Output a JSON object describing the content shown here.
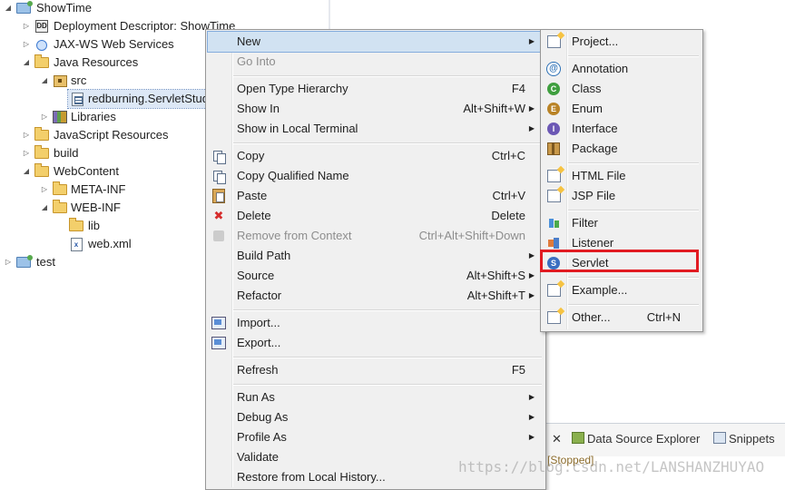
{
  "explorer": {
    "items": [
      {
        "label": "ShowTime",
        "icon": "web-project-icon",
        "expanded": true
      },
      {
        "label": "Deployment Descriptor: ShowTime",
        "icon": "deployment-descriptor-icon",
        "expanded": false
      },
      {
        "label": "JAX-WS Web Services",
        "icon": "jaxws-icon",
        "expanded": false
      },
      {
        "label": "Java Resources",
        "icon": "java-resources-icon",
        "expanded": true
      },
      {
        "label": "src",
        "icon": "source-folder-icon",
        "expanded": true
      },
      {
        "label": "redburning.ServletStud",
        "icon": "package-icon",
        "selected": true
      },
      {
        "label": "Libraries",
        "icon": "libraries-icon",
        "expanded": false
      },
      {
        "label": "JavaScript Resources",
        "icon": "javascript-resources-icon",
        "expanded": false
      },
      {
        "label": "build",
        "icon": "folder-icon",
        "expanded": false
      },
      {
        "label": "WebContent",
        "icon": "folder-icon",
        "expanded": true
      },
      {
        "label": "META-INF",
        "icon": "folder-icon",
        "expanded": false
      },
      {
        "label": "WEB-INF",
        "icon": "folder-icon",
        "expanded": true
      },
      {
        "label": "lib",
        "icon": "folder-icon"
      },
      {
        "label": "web.xml",
        "icon": "xml-file-icon"
      },
      {
        "label": "test",
        "icon": "web-project-icon",
        "expanded": false
      }
    ]
  },
  "context_menu": {
    "items": [
      {
        "label": "New",
        "shortcut": "",
        "submenu": true,
        "highlighted": true
      },
      {
        "label": "Go Into",
        "shortcut": "",
        "disabled": true
      },
      {
        "label": "Open Type Hierarchy",
        "shortcut": "F4"
      },
      {
        "label": "Show In",
        "shortcut": "Alt+Shift+W",
        "submenu": true
      },
      {
        "label": "Show in Local Terminal",
        "shortcut": "",
        "submenu": true
      },
      {
        "label": "Copy",
        "shortcut": "Ctrl+C",
        "icon": "copy-icon"
      },
      {
        "label": "Copy Qualified Name",
        "shortcut": "",
        "icon": "copy-qualified-name-icon"
      },
      {
        "label": "Paste",
        "shortcut": "Ctrl+V",
        "icon": "paste-icon"
      },
      {
        "label": "Delete",
        "shortcut": "Delete",
        "icon": "delete-icon"
      },
      {
        "label": "Remove from Context",
        "shortcut": "Ctrl+Alt+Shift+Down",
        "disabled": true,
        "icon": "remove-from-context-icon"
      },
      {
        "label": "Build Path",
        "shortcut": "",
        "submenu": true
      },
      {
        "label": "Source",
        "shortcut": "Alt+Shift+S",
        "submenu": true
      },
      {
        "label": "Refactor",
        "shortcut": "Alt+Shift+T",
        "submenu": true
      },
      {
        "label": "Import...",
        "shortcut": "",
        "icon": "import-icon"
      },
      {
        "label": "Export...",
        "shortcut": "",
        "icon": "export-icon"
      },
      {
        "label": "Refresh",
        "shortcut": "F5"
      },
      {
        "label": "Run As",
        "shortcut": "",
        "submenu": true
      },
      {
        "label": "Debug As",
        "shortcut": "",
        "submenu": true
      },
      {
        "label": "Profile As",
        "shortcut": "",
        "submenu": true
      },
      {
        "label": "Validate",
        "shortcut": ""
      },
      {
        "label": "Restore from Local History...",
        "shortcut": ""
      }
    ]
  },
  "new_submenu": {
    "items": [
      {
        "label": "Project...",
        "shortcut": "",
        "icon": "new-project-icon"
      },
      {
        "label": "Annotation",
        "shortcut": "",
        "icon": "annotation-icon"
      },
      {
        "label": "Class",
        "shortcut": "",
        "icon": "class-icon"
      },
      {
        "label": "Enum",
        "shortcut": "",
        "icon": "enum-icon"
      },
      {
        "label": "Interface",
        "shortcut": "",
        "icon": "interface-icon"
      },
      {
        "label": "Package",
        "shortcut": "",
        "icon": "package-icon"
      },
      {
        "label": "HTML File",
        "shortcut": "",
        "icon": "html-file-icon"
      },
      {
        "label": "JSP File",
        "shortcut": "",
        "icon": "jsp-file-icon"
      },
      {
        "label": "Filter",
        "shortcut": "",
        "icon": "filter-icon"
      },
      {
        "label": "Listener",
        "shortcut": "",
        "icon": "listener-icon"
      },
      {
        "label": "Servlet",
        "shortcut": "",
        "icon": "servlet-icon",
        "boxed": true
      },
      {
        "label": "Example...",
        "shortcut": "",
        "icon": "example-icon"
      },
      {
        "label": "Other...",
        "shortcut": "Ctrl+N",
        "icon": "other-wizard-icon"
      }
    ],
    "highlight_box_color": "#e11b22"
  },
  "bottom_panel": {
    "tabs": [
      {
        "label": "Data Source Explorer",
        "icon": "data-source-explorer-icon"
      },
      {
        "label": "Snippets",
        "icon": "snippets-icon"
      }
    ],
    "server_status": "[Stopped]"
  },
  "watermark": "https://blog.csdn.net/LANSHANZHUYAO"
}
